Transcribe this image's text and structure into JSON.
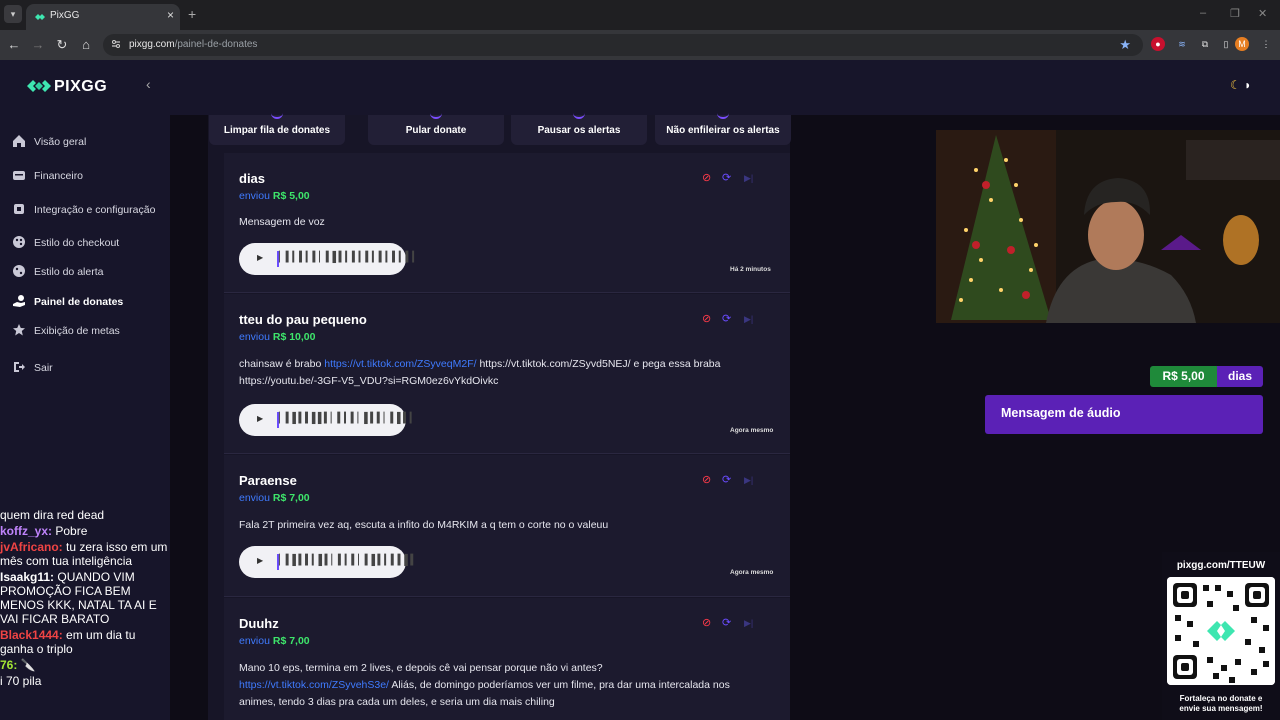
{
  "browser": {
    "tab_title": "PixGG",
    "url_domain": "pixgg.com",
    "url_path": "/painel-de-donates",
    "profile_initial": "M"
  },
  "sidebar": {
    "brand": "PIXGG",
    "items": [
      {
        "label": "Visão geral",
        "icon": "home-icon"
      },
      {
        "label": "Financeiro",
        "icon": "wallet-icon"
      },
      {
        "label": "Integração e configuração",
        "icon": "plug-icon"
      },
      {
        "label": "Estilo do checkout",
        "icon": "palette-icon"
      },
      {
        "label": "Estilo do alerta",
        "icon": "palette-icon"
      },
      {
        "label": "Painel de donates",
        "icon": "hand-coin-icon"
      },
      {
        "label": "Exibição de metas",
        "icon": "star-icon"
      },
      {
        "label": "Sair",
        "icon": "logout-icon"
      }
    ],
    "active_index": 5
  },
  "actions": [
    {
      "label": "Limpar fila de donates"
    },
    {
      "label": "Pular donate"
    },
    {
      "label": "Pausar os alertas"
    },
    {
      "label": "Não enfileirar os alertas"
    }
  ],
  "donates": [
    {
      "name": "dias",
      "sent_label": "enviou",
      "amount": "R$ 5,00",
      "message": "Mensagem de voz",
      "time": "Há 2 minutos",
      "waveform": "▏▍▎▍▎▍▏▍▌▍▎▍▎▍▎▍▎▍▎▍▎"
    },
    {
      "name": "tteu do pau pequeno",
      "sent_label": "enviou",
      "amount": "R$ 10,00",
      "message_pre": "chainsaw é brabo ",
      "message_link": "https://vt.tiktok.com/ZSyveqM2F/",
      "message_post": " https://vt.tiktok.com/ZSyvd5NEJ/ e pega essa braba https://youtu.be/-3GF-V5_VDU?si=RGM0ez6vYkdOivkc",
      "time": "Agora mesmo",
      "waveform": "▏▍▌▍▍▌▌▍▏▍▎▍▏▌▍▍▏▍▌▍▎"
    },
    {
      "name": "Paraense",
      "sent_label": "enviou",
      "amount": "R$ 7,00",
      "message": "Fala 2T primeira vez aq, escuta a infito do M4RKIM a q tem o corte no o valeuu",
      "time": "Agora mesmo",
      "waveform": "▏▍▌▍▍▎▌▍▏▍▎▍▏▍▌▍▎▍▍▌▍"
    },
    {
      "name": "Duuhz",
      "sent_label": "enviou",
      "amount": "R$ 7,00",
      "message_line1": "Mano 10 eps, termina em 2 lives, e depois cê vai pensar porque não vi antes?",
      "message_link": "https://vt.tiktok.com/ZSyvehS3e/",
      "message_post": " Aliás, de domingo poderíamos ver um filme, pra dar uma intercalada nos animes, tendo 3 dias pra cada um deles, e seria um dia mais chiling"
    }
  ],
  "alert": {
    "amount": "R$ 5,00",
    "name": "dias",
    "message": "Mensagem de áudio"
  },
  "qr": {
    "url": "pixgg.com/TTEUW",
    "cta_line1": "Fortaleça no donate e",
    "cta_line2": "envie sua mensagem!"
  },
  "chat": [
    {
      "user": "",
      "text": "quem dira red dead",
      "color": "#ffffff"
    },
    {
      "user": "koffz_yx:",
      "text": " Pobre",
      "color": "#c084fc"
    },
    {
      "user": "jvAfricano:",
      "text": " tu zera isso em um mês com tua inteligência",
      "color": "#ef4444"
    },
    {
      "user": "Isaakg11:",
      "text": " QUANDO VIM PROMOÇÃO FICA BEM MENOS KKK, NATAL TA AI E VAI FICAR BARATO",
      "color": "#ffffff"
    },
    {
      "user": "Black1444:",
      "text": " em um dia tu ganha o triplo",
      "color": "#ef4444"
    },
    {
      "user": "76:",
      "text": " 🔪",
      "color": "#a3e635"
    },
    {
      "user": "",
      "text": "i 70 pila",
      "color": "#ffffff"
    }
  ],
  "colors": {
    "accent": "#5b21b6",
    "amount_green": "#3ee66b",
    "link_blue": "#3f7bff",
    "block_red": "#ff3b4a"
  }
}
